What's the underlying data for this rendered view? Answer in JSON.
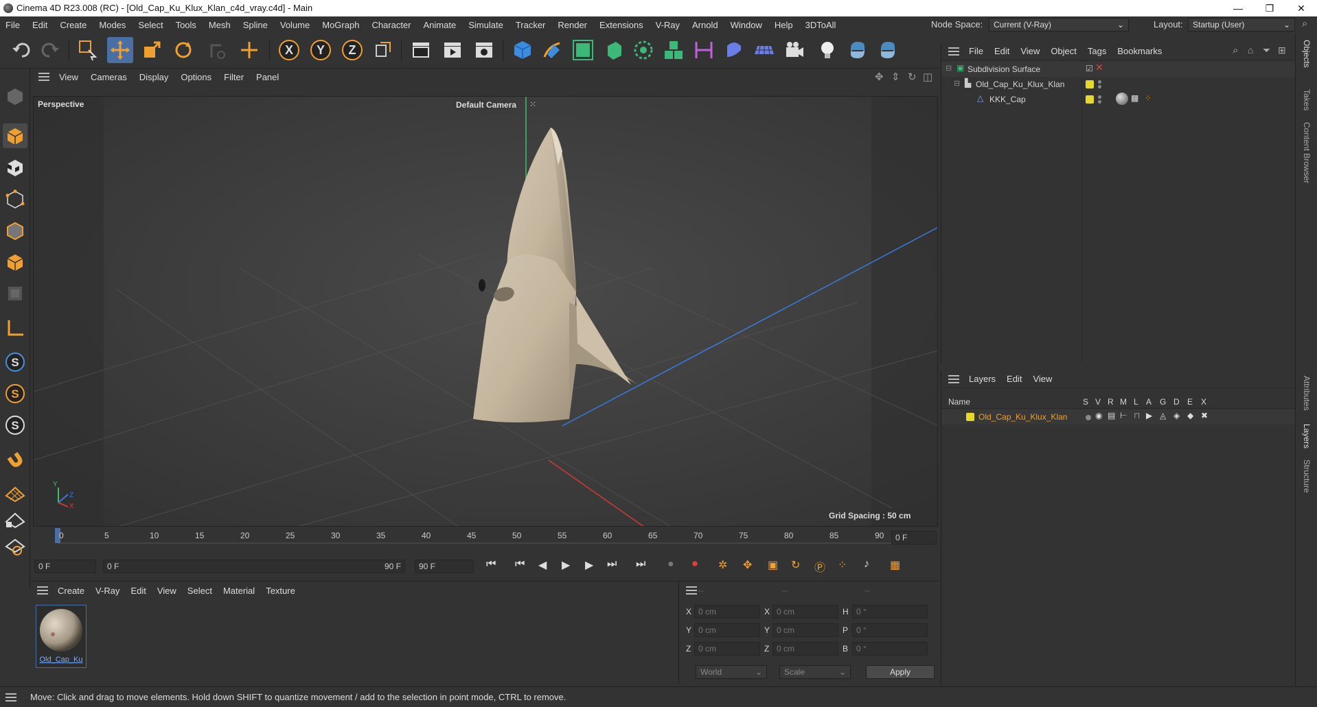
{
  "window": {
    "title": "Cinema 4D R23.008 (RC) - [Old_Cap_Ku_Klux_Klan_c4d_vray.c4d] - Main",
    "minimize": "—",
    "maximize": "❐",
    "close": "✕"
  },
  "menu": [
    "File",
    "Edit",
    "Create",
    "Modes",
    "Select",
    "Tools",
    "Mesh",
    "Spline",
    "Volume",
    "MoGraph",
    "Character",
    "Animate",
    "Simulate",
    "Tracker",
    "Render",
    "Extensions",
    "V-Ray",
    "Arnold",
    "Window",
    "Help",
    "3DToAll"
  ],
  "node_space": {
    "label": "Node Space:",
    "value": "Current (V-Ray)"
  },
  "layout": {
    "label": "Layout:",
    "value": "Startup (User)"
  },
  "viewport": {
    "menu": [
      "View",
      "Cameras",
      "Display",
      "Options",
      "Filter",
      "Panel"
    ],
    "name": "Perspective",
    "camera": "Default Camera",
    "grid_spacing": "Grid Spacing : 50 cm",
    "axis": {
      "y": "Y",
      "z": "Z",
      "x": "X"
    }
  },
  "timeline": {
    "ticks": [
      "0",
      "5",
      "10",
      "15",
      "20",
      "25",
      "30",
      "35",
      "40",
      "45",
      "50",
      "55",
      "60",
      "65",
      "70",
      "75",
      "80",
      "85",
      "90"
    ],
    "current_frame": "0 F",
    "start_frame": "0 F",
    "range_start": "0 F",
    "range_end": "90 F",
    "end_frame": "90 F"
  },
  "object_manager": {
    "menu": [
      "File",
      "Edit",
      "View",
      "Object",
      "Tags",
      "Bookmarks"
    ],
    "items": [
      {
        "name": "Subdivision Surface",
        "level": 0
      },
      {
        "name": "Old_Cap_Ku_Klux_Klan",
        "level": 1
      },
      {
        "name": "KKK_Cap",
        "level": 2
      }
    ]
  },
  "layer_manager": {
    "menu": [
      "Layers",
      "Edit",
      "View"
    ],
    "columns": [
      "Name",
      "S",
      "V",
      "R",
      "M",
      "L",
      "A",
      "G",
      "D",
      "E",
      "X"
    ],
    "layer_name": "Old_Cap_Ku_Klux_Klan"
  },
  "material_manager": {
    "menu": [
      "Create",
      "V-Ray",
      "Edit",
      "View",
      "Select",
      "Material",
      "Texture"
    ],
    "material_name": "Old_Cap_Ku"
  },
  "coordinates": {
    "headers": [
      "--",
      "--",
      "--"
    ],
    "rows": [
      {
        "a": "X",
        "av": "0 cm",
        "b": "X",
        "bv": "0 cm",
        "c": "H",
        "cv": "0 °"
      },
      {
        "a": "Y",
        "av": "0 cm",
        "b": "Y",
        "bv": "0 cm",
        "c": "P",
        "cv": "0 °"
      },
      {
        "a": "Z",
        "av": "0 cm",
        "b": "Z",
        "bv": "0 cm",
        "c": "B",
        "cv": "0 °"
      }
    ],
    "space": "World",
    "mode": "Scale",
    "apply": "Apply"
  },
  "right_tabs": [
    "Objects",
    "Takes",
    "Content Browser",
    "Attributes",
    "Layers",
    "Structure"
  ],
  "status": "Move: Click and drag to move elements. Hold down SHIFT to quantize movement / add to the selection in point mode, CTRL to remove.",
  "colors": {
    "accent": "#4a90d9",
    "orange": "#f0a030",
    "layer_yellow": "#e6d92c",
    "layer_text": "#f0a030"
  }
}
